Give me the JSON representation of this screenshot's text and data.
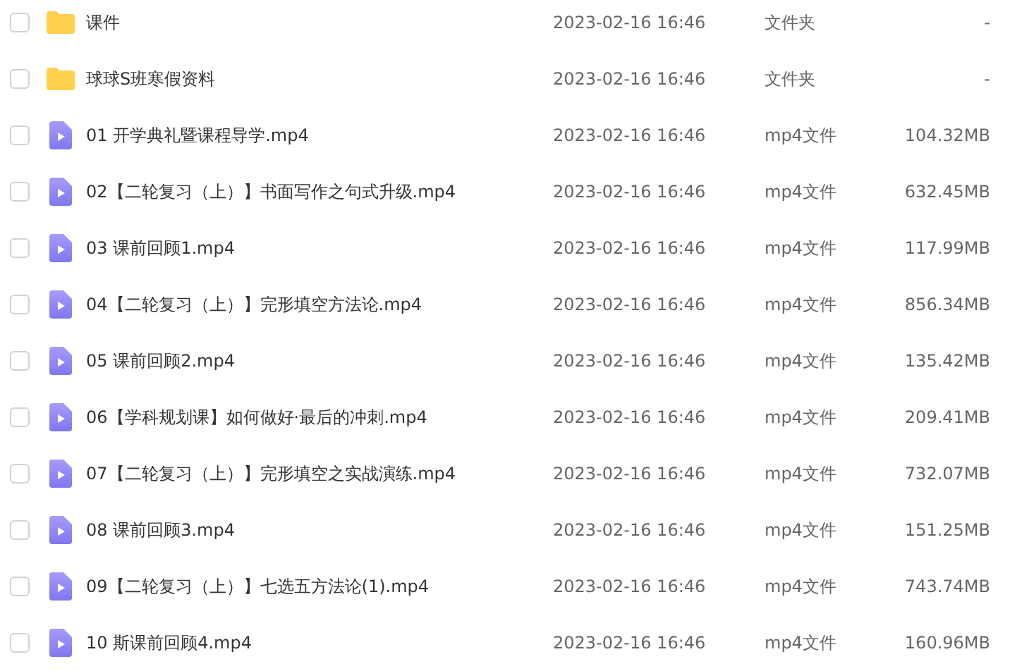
{
  "files": [
    {
      "kind": "folder",
      "checked": false,
      "name": "课件",
      "modified": "2023-02-16 16:46",
      "type": "文件夹",
      "size": "-"
    },
    {
      "kind": "folder",
      "checked": false,
      "name": "球球S班寒假资料",
      "modified": "2023-02-16 16:46",
      "type": "文件夹",
      "size": "-"
    },
    {
      "kind": "video",
      "checked": false,
      "name": "01 开学典礼暨课程导学.mp4",
      "modified": "2023-02-16 16:46",
      "type": "mp4文件",
      "size": "104.32MB"
    },
    {
      "kind": "video",
      "checked": false,
      "name": "02【二轮复习（上）】书面写作之句式升级.mp4",
      "modified": "2023-02-16 16:46",
      "type": "mp4文件",
      "size": "632.45MB"
    },
    {
      "kind": "video",
      "checked": false,
      "name": "03 课前回顾1.mp4",
      "modified": "2023-02-16 16:46",
      "type": "mp4文件",
      "size": "117.99MB"
    },
    {
      "kind": "video",
      "checked": false,
      "name": "04【二轮复习（上）】完形填空方法论.mp4",
      "modified": "2023-02-16 16:46",
      "type": "mp4文件",
      "size": "856.34MB"
    },
    {
      "kind": "video",
      "checked": false,
      "name": "05 课前回顾2.mp4",
      "modified": "2023-02-16 16:46",
      "type": "mp4文件",
      "size": "135.42MB"
    },
    {
      "kind": "video",
      "checked": false,
      "name": "06【学科规划课】如何做好·最后的冲刺.mp4",
      "modified": "2023-02-16 16:46",
      "type": "mp4文件",
      "size": "209.41MB"
    },
    {
      "kind": "video",
      "checked": false,
      "name": "07【二轮复习（上）】完形填空之实战演练.mp4",
      "modified": "2023-02-16 16:46",
      "type": "mp4文件",
      "size": "732.07MB"
    },
    {
      "kind": "video",
      "checked": false,
      "name": "08 课前回顾3.mp4",
      "modified": "2023-02-16 16:46",
      "type": "mp4文件",
      "size": "151.25MB"
    },
    {
      "kind": "video",
      "checked": false,
      "name": "09【二轮复习（上）】七选五方法论(1).mp4",
      "modified": "2023-02-16 16:46",
      "type": "mp4文件",
      "size": "743.74MB"
    },
    {
      "kind": "video",
      "checked": false,
      "name": "10 斯课前回顾4.mp4",
      "modified": "2023-02-16 16:46",
      "type": "mp4文件",
      "size": "160.96MB"
    }
  ]
}
